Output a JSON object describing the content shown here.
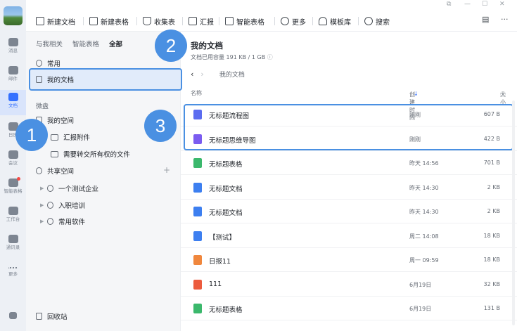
{
  "rail": [
    {
      "label": "消息",
      "icon": "chat-icon"
    },
    {
      "label": "邮件",
      "icon": "mail-icon"
    },
    {
      "label": "文档",
      "icon": "docs-icon",
      "active": true
    },
    {
      "label": "日历",
      "icon": "calendar-icon"
    },
    {
      "label": "会议",
      "icon": "meeting-icon"
    },
    {
      "label": "智能表格",
      "icon": "smart-sheet-icon",
      "badge": true
    },
    {
      "label": "工作台",
      "icon": "workbench-icon"
    },
    {
      "label": "通讯录",
      "icon": "contacts-icon"
    },
    {
      "label": "更多",
      "icon": "more-icon"
    }
  ],
  "toolbar": {
    "new_doc": "新建文档",
    "new_sheet": "新建表格",
    "collect": "收集表",
    "report": "汇报",
    "smart_sheet": "智能表格",
    "more": "更多",
    "templates": "模板库",
    "search": "搜索"
  },
  "nav": {
    "tabs": [
      "与我相关",
      "智能表格",
      "全部"
    ],
    "common": "常用",
    "my_docs": "我的文档",
    "group_label": "微盘",
    "my_space": "我的空间",
    "report_attach": "汇报附件",
    "transfer_files": "需要转交所有权的文件",
    "shared_space": "共享空间",
    "shared_items": [
      "一个测试企业",
      "入职培训",
      "常用软件"
    ],
    "recycle": "回收站"
  },
  "main": {
    "title": "我的文档",
    "quota": "文档已用容量 191 KB / 1 GB",
    "crumb": "我的文档",
    "col_name": "名称",
    "col_time": "创建时间",
    "col_size": "大小",
    "files": [
      {
        "name": "无标题流程图",
        "time": "刚刚",
        "size": "607 B",
        "color": "#5b6cf0"
      },
      {
        "name": "无标题思维导图",
        "time": "刚刚",
        "size": "422 B",
        "color": "#7b5cf0"
      },
      {
        "name": "无标题表格",
        "time": "昨天 14:56",
        "size": "701 B",
        "color": "#3bb86c"
      },
      {
        "name": "无标题文档",
        "time": "昨天 14:30",
        "size": "2 KB",
        "color": "#3d7ff0"
      },
      {
        "name": "无标题文档",
        "time": "昨天 14:30",
        "size": "2 KB",
        "color": "#3d7ff0"
      },
      {
        "name": "【测试】",
        "time": "周二 14:08",
        "size": "18 KB",
        "color": "#3d7ff0"
      },
      {
        "name": "日报11",
        "time": "周一 09:59",
        "size": "18 KB",
        "color": "#f0873d"
      },
      {
        "name": "111",
        "time": "6月19日",
        "size": "32 KB",
        "color": "#ec5b3d"
      },
      {
        "name": "无标题表格",
        "time": "6月19日",
        "size": "131 B",
        "color": "#3bb86c"
      }
    ]
  },
  "callouts": [
    "1",
    "2",
    "3"
  ]
}
